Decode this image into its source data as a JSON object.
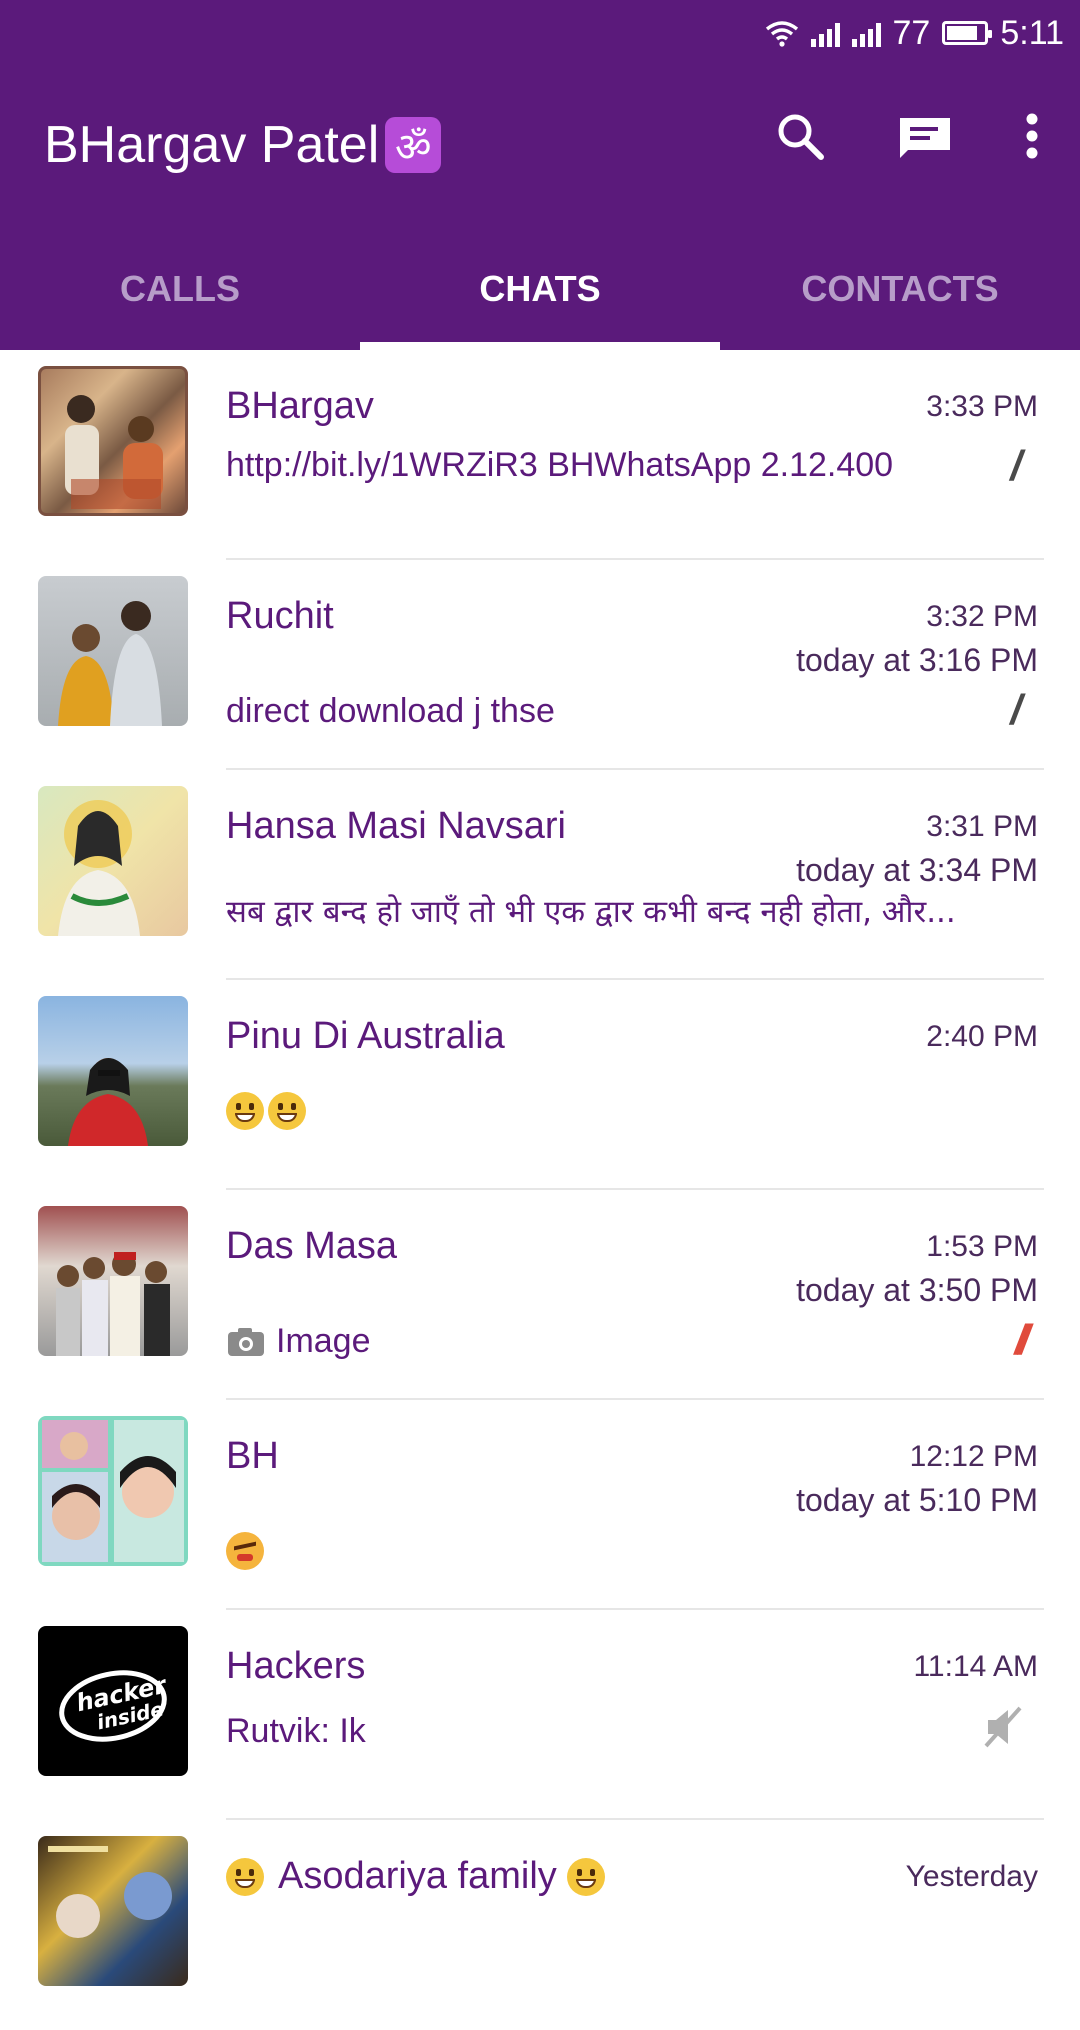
{
  "status_bar": {
    "battery": "77",
    "time": "5:11"
  },
  "header": {
    "title": "BHargav Patel",
    "title_symbol": "ॐ"
  },
  "tabs": [
    {
      "label": "CALLS",
      "active": false
    },
    {
      "label": "CHATS",
      "active": true
    },
    {
      "label": "CONTACTS",
      "active": false
    }
  ],
  "chats": [
    {
      "name": "BHargav",
      "time": "3:33 PM",
      "message": "http://bit.ly/1WRZiR3  BHWhatsApp 2.12.400",
      "tick": "/"
    },
    {
      "name": "Ruchit",
      "time": "3:32 PM",
      "subtime": "today at 3:16 PM",
      "message": "direct download j thse",
      "tick": "/"
    },
    {
      "name": "Hansa Masi Navsari",
      "time": "3:31 PM",
      "subtime": "today at 3:34 PM",
      "message": "सब द्वार बन्द हो जाएँ तो भी एक द्वार कभी बन्द नही होता, और..."
    },
    {
      "name": "Pinu Di Australia",
      "time": "2:40 PM"
    },
    {
      "name": "Das Masa",
      "time": "1:53 PM",
      "subtime": "today at 3:50 PM",
      "message": "Image",
      "tick": "//"
    },
    {
      "name": "BH",
      "time": "12:12 PM",
      "subtime": "today at 5:10 PM"
    },
    {
      "name": "Hackers",
      "time": "11:14 AM",
      "message": "Rutvik:  Ik",
      "avatar_text": "hacker inside"
    },
    {
      "name": "Asodariya family",
      "time": "Yesterday"
    }
  ],
  "icons": {
    "search": "search-icon",
    "compose": "new-chat-icon",
    "menu": "more-vert-icon",
    "camera": "camera-icon",
    "mute": "muted-speaker-icon"
  },
  "colors": {
    "primary": "#5b1a7b",
    "tab_inactive": "#b79dc9",
    "read_tick": "#e04b3c"
  }
}
